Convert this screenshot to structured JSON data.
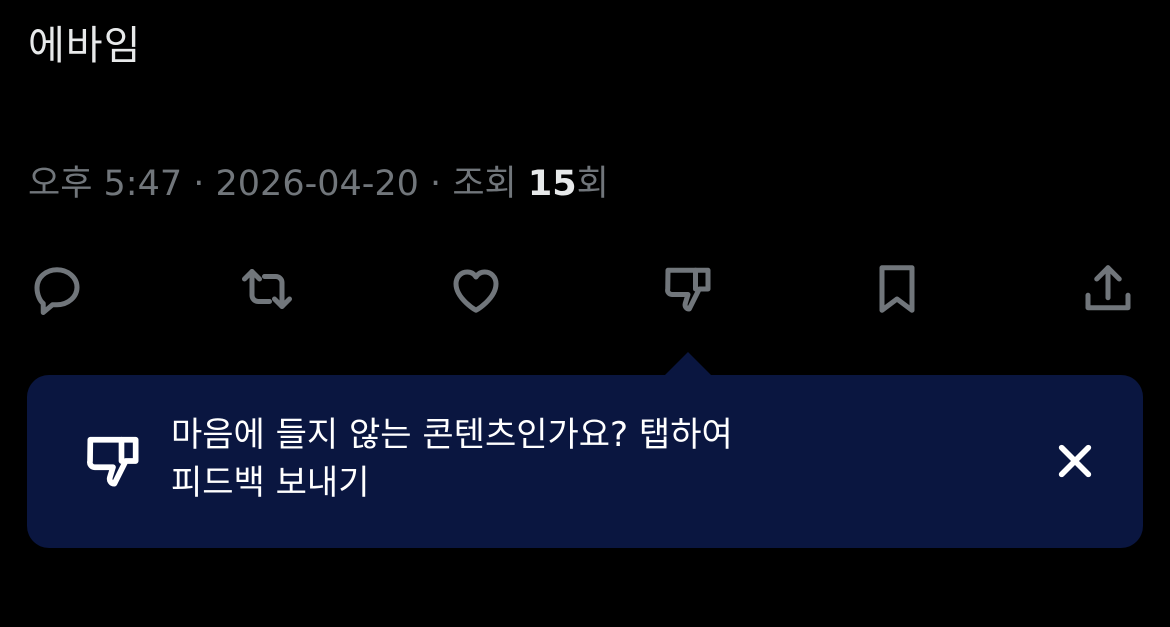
{
  "post": {
    "text": "에바임",
    "time": "오후 5:47",
    "date": "2026-04-20",
    "views_label": "조회",
    "views_count": "15",
    "views_suffix": "회",
    "separator": " · "
  },
  "actions": [
    {
      "name": "reply",
      "icon": "reply-icon"
    },
    {
      "name": "repost",
      "icon": "repost-icon"
    },
    {
      "name": "like",
      "icon": "heart-icon"
    },
    {
      "name": "dislike",
      "icon": "thumbs-down-icon"
    },
    {
      "name": "bookmark",
      "icon": "bookmark-icon"
    },
    {
      "name": "share",
      "icon": "share-icon"
    }
  ],
  "tooltip": {
    "line1": "마음에 들지 않는 콘텐츠인가요? 탭하여",
    "line2": "피드백 보내기",
    "icon": "thumbs-down-icon",
    "close_icon": "close-icon"
  },
  "colors": {
    "background": "#000000",
    "text_primary": "#e7e9ea",
    "text_secondary": "#71767b",
    "tooltip_bg": "#0a1640"
  }
}
